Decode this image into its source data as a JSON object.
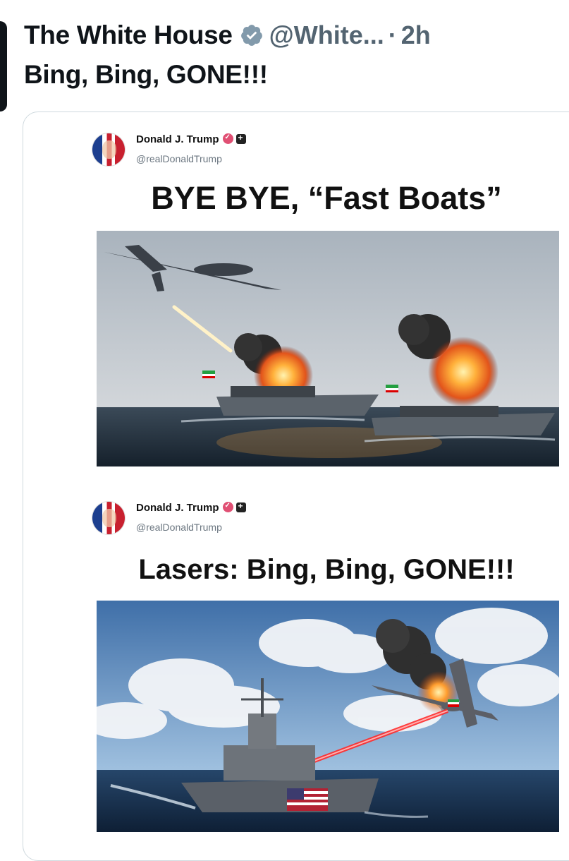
{
  "tweet": {
    "author": "The White House",
    "handle": "@White...",
    "separator": "·",
    "time": "2h",
    "text": "Bing, Bing, GONE!!!"
  },
  "posts": [
    {
      "name": "Donald J. Trump",
      "handle": "@realDonaldTrump",
      "headline": "BYE BYE, “Fast Boats”",
      "image": "drone-firing-missile-at-burning-fast-boats"
    },
    {
      "name": "Donald J. Trump",
      "handle": "@realDonaldTrump",
      "headline": "Lasers: Bing, Bing, GONE!!!",
      "image": "warship-laser-hitting-drone"
    }
  ],
  "icons": {
    "verified": "verified-badge-icon",
    "post_verified": "pink-verified-icon",
    "post_plus": "plus-badge-icon"
  },
  "colors": {
    "text": "#0f1419",
    "muted": "#536471",
    "verified_gray": "#829aab"
  }
}
